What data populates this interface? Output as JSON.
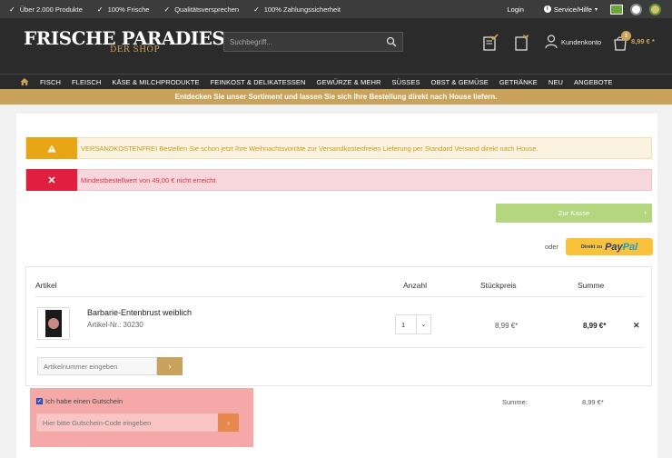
{
  "topbar": {
    "usps": [
      "Über 2.000 Produkte",
      "100% Frische",
      "Qualitätsversprechen",
      "100% Zahlungssicherheit"
    ],
    "login": "Login",
    "service": "Service/Hilfe"
  },
  "header": {
    "logo_main": "FRISCHE PARADIES",
    "logo_sub": "DER SHOP",
    "search_placeholder": "Suchbegriff...",
    "account_label": "Kundenkonto",
    "cart_count": "1",
    "cart_total": "8,99 € *"
  },
  "nav": {
    "items": [
      "FISCH",
      "FLEISCH",
      "KÄSE & MILCHPRODUKTE",
      "FEINKOST & DELIKATESSEN",
      "GEWÜRZE & MEHR",
      "SÜSSES",
      "OBST & GEMÜSE",
      "GETRÄNKE",
      "NEU",
      "ANGEBOTE"
    ]
  },
  "announce": "Entdecken Sie unser Sortiment und lassen Sie sich Ihre Bestellung direkt nach House liefern.",
  "alerts": {
    "warning": "VERSANDKOSTENFREI Bestellen Sie schon jetzt Ihre Weihnachtsvorräte zur Versandkostenfreien Lieferung per Standard Versand direkt nach House.",
    "error": "Mindestbestellwert von 49,00 € nicht erreicht"
  },
  "checkout": {
    "button": "Zur Kasse",
    "or": "oder",
    "paypal_prefix": "Direkt zu",
    "paypal_pay": "Pay",
    "paypal_pal": "Pal"
  },
  "table": {
    "headers": {
      "article": "Artikel",
      "qty": "Anzahl",
      "unit_price": "Stückpreis",
      "sum": "Summe"
    },
    "rows": [
      {
        "name": "Barbarie-Entenbrust weiblich",
        "sku": "Artikel-Nr.: 30230",
        "qty": "1",
        "unit_price": "8,99 €*",
        "total": "8,99 €*"
      }
    ],
    "sku_placeholder": "Artikelnummer eingeben"
  },
  "voucher": {
    "checkbox_label": "Ich habe einen Gutschein",
    "placeholder": "Hier bitte Gutschein-Code eingeben"
  },
  "summary": {
    "label": "Summe:",
    "value": "8,99 €*"
  }
}
